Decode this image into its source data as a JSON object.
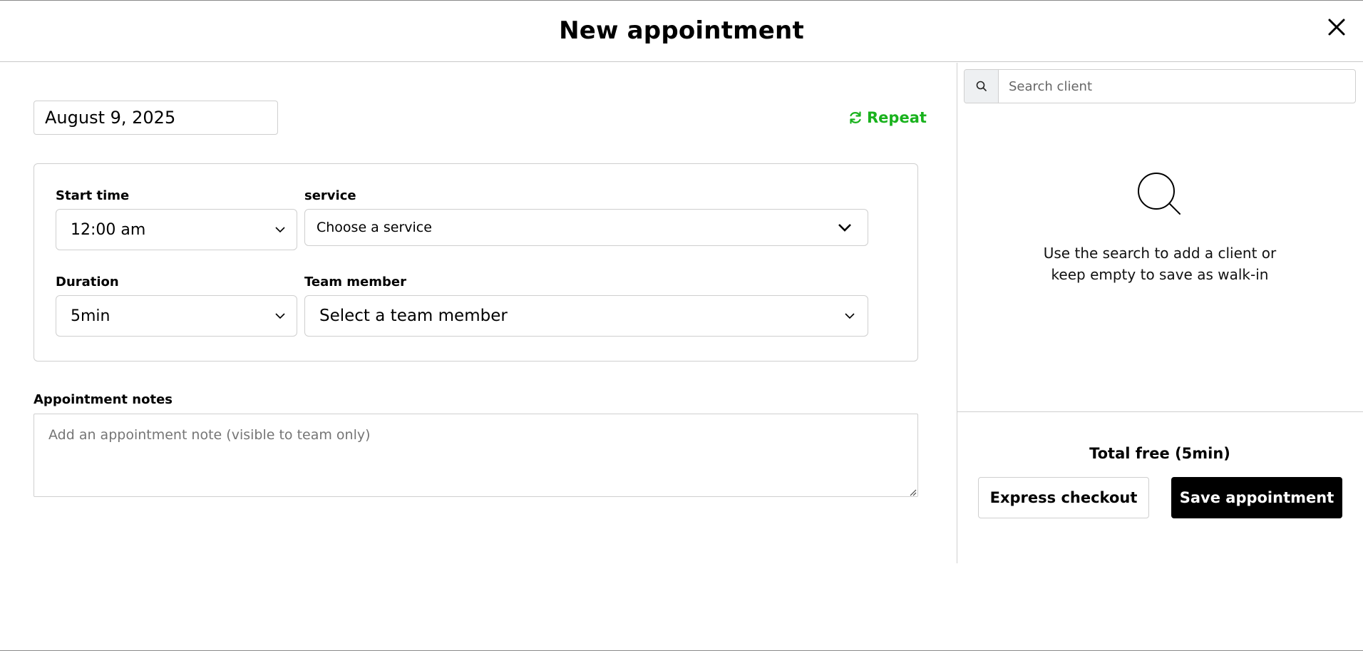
{
  "dialog": {
    "title": "New appointment",
    "close_icon": "close-icon"
  },
  "form": {
    "date": "August 9, 2025",
    "repeat_label": "Repeat",
    "repeat_icon": "refresh-icon",
    "accent_color": "#19b21d",
    "start_time": {
      "label": "Start time",
      "value": "12:00 am"
    },
    "service": {
      "label": "service",
      "value": "Choose a service"
    },
    "duration": {
      "label": "Duration",
      "value": "5min"
    },
    "team_member": {
      "label": "Team member",
      "value": "Select a team member"
    },
    "notes": {
      "label": "Appointment notes",
      "placeholder": "Add an appointment note (visible to team only)"
    }
  },
  "client_panel": {
    "search_placeholder": "Search client",
    "search_icon": "search-icon",
    "empty_icon": "magnifier-icon",
    "empty_line1": "Use the search to add a client or",
    "empty_line2": "keep empty to save as walk-in"
  },
  "footer": {
    "total": "Total free (5min)",
    "express_checkout": "Express checkout",
    "save_appointment": "Save appointment"
  }
}
